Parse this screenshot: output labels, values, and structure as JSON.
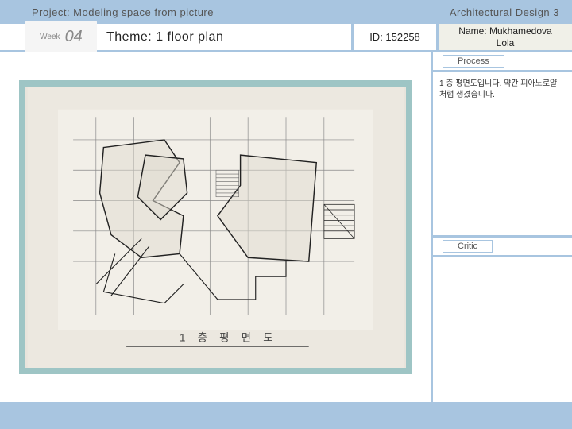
{
  "header": {
    "project": "Project: Modeling space from picture",
    "course": "Architectural Design  3"
  },
  "info": {
    "week_label": "Week",
    "week_num": "04",
    "theme": "Theme: 1 floor plan",
    "id": "ID: 152258",
    "name_line1": "Name: Mukhamedova",
    "name_line2": "Lola"
  },
  "sections": {
    "process_title": "Process",
    "process_text": "1 층 평면도입니다. 약간 피아노로얄 처럼 생겼습니다.",
    "critic_title": "Critic"
  }
}
